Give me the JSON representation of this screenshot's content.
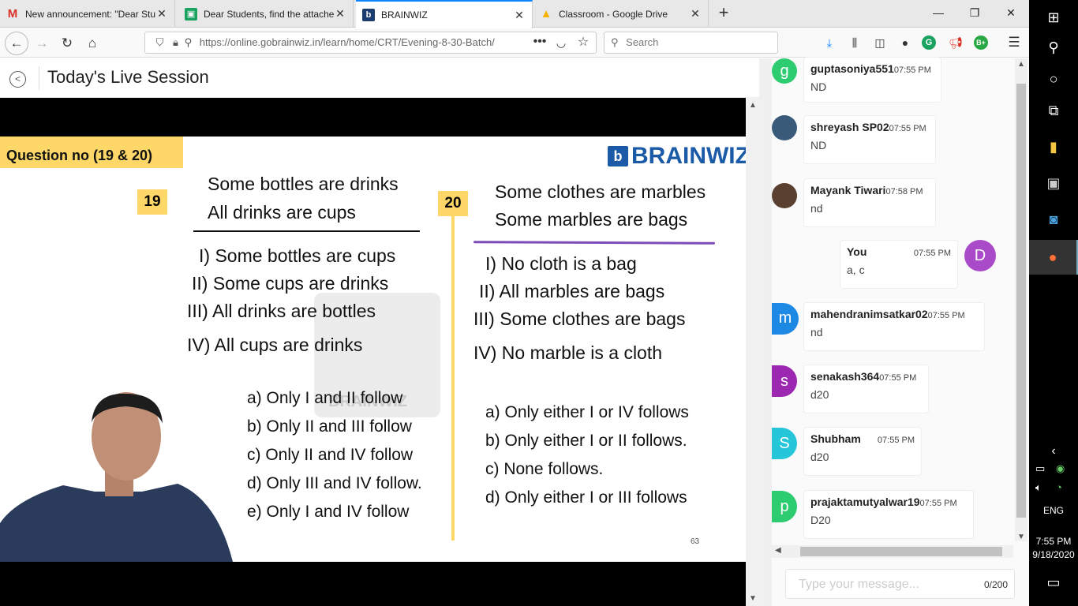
{
  "browser": {
    "tabs": [
      {
        "title": "New announcement: \"Dear Stu",
        "favicon": "gmail-icon",
        "active": false
      },
      {
        "title": "Dear Students, find the attache",
        "favicon": "classroom-icon",
        "active": false
      },
      {
        "title": "BRAINWIZ",
        "favicon": "brainwiz-icon",
        "active": true
      },
      {
        "title": "Classroom - Google Drive",
        "favicon": "drive-icon",
        "active": false
      }
    ],
    "url": "https://online.gobrainwiz.in/learn/home/CRT/Evening-8-30-Batch/",
    "url_domain": "gobrainwiz.in",
    "search_placeholder": "Search",
    "ext_badge": "B+",
    "ext_g": "G"
  },
  "page": {
    "title": "Today's Live Session"
  },
  "slide": {
    "header": "Question no (19 & 20)",
    "logo": "BRAINWIZ",
    "watermark": "BRAINWIZ",
    "page_number": "63",
    "q19": {
      "number": "19",
      "statements": [
        "Some bottles are drinks",
        "All drinks are cups"
      ],
      "conclusions": [
        "I) Some bottles are cups",
        "II) Some cups are drinks",
        "III) All drinks are bottles",
        "IV) All cups are drinks"
      ],
      "options": [
        "a) Only I and II follow",
        "b) Only II and III follow",
        "c) Only II and IV follow",
        "d) Only III and IV follow.",
        "e) Only I and IV follow"
      ]
    },
    "q20": {
      "number": "20",
      "statements": [
        "Some clothes are marbles",
        "Some marbles are bags"
      ],
      "conclusions": [
        "I) No cloth is a bag",
        "II) All marbles are bags",
        "III) Some clothes are bags",
        "IV) No marble is a cloth"
      ],
      "options": [
        "a) Only either I or IV follows",
        "b) Only either I or II follows.",
        "c) None follows.",
        "d) Only either I or III follows"
      ]
    }
  },
  "chat": {
    "messages": [
      {
        "user": "guptasoniya551",
        "time": "07:55 PM",
        "text": "ND",
        "initial": "g",
        "color": "#2ecc71"
      },
      {
        "user": "shreyash SP02",
        "time": "07:55 PM",
        "text": "ND",
        "initial": "",
        "color": "#3a5a7a"
      },
      {
        "user": "Mayank Tiwari",
        "time": "07:58 PM",
        "text": "nd",
        "initial": "",
        "color": "#5a4030"
      },
      {
        "user": "You",
        "time": "07:55 PM",
        "text": "a, c",
        "initial": "D",
        "color": "#a94bc9"
      },
      {
        "user": "mahendranimsatkar02",
        "time": "07:55 PM",
        "text": "nd",
        "initial": "m",
        "color": "#1e88e5"
      },
      {
        "user": "senakash364",
        "time": "07:55 PM",
        "text": "d20",
        "initial": "s",
        "color": "#9c27b0"
      },
      {
        "user": "Shubham",
        "time": "07:55 PM",
        "text": "d20",
        "initial": "S",
        "color": "#26c6da"
      },
      {
        "user": "prajaktamutyalwar19",
        "time": "07:55 PM",
        "text": "D20",
        "initial": "p",
        "color": "#2ecc71"
      }
    ],
    "input_placeholder": "Type your message...",
    "counter": "0/200"
  },
  "taskbar": {
    "language": "ENG",
    "time": "7:55 PM",
    "date": "9/18/2020"
  }
}
